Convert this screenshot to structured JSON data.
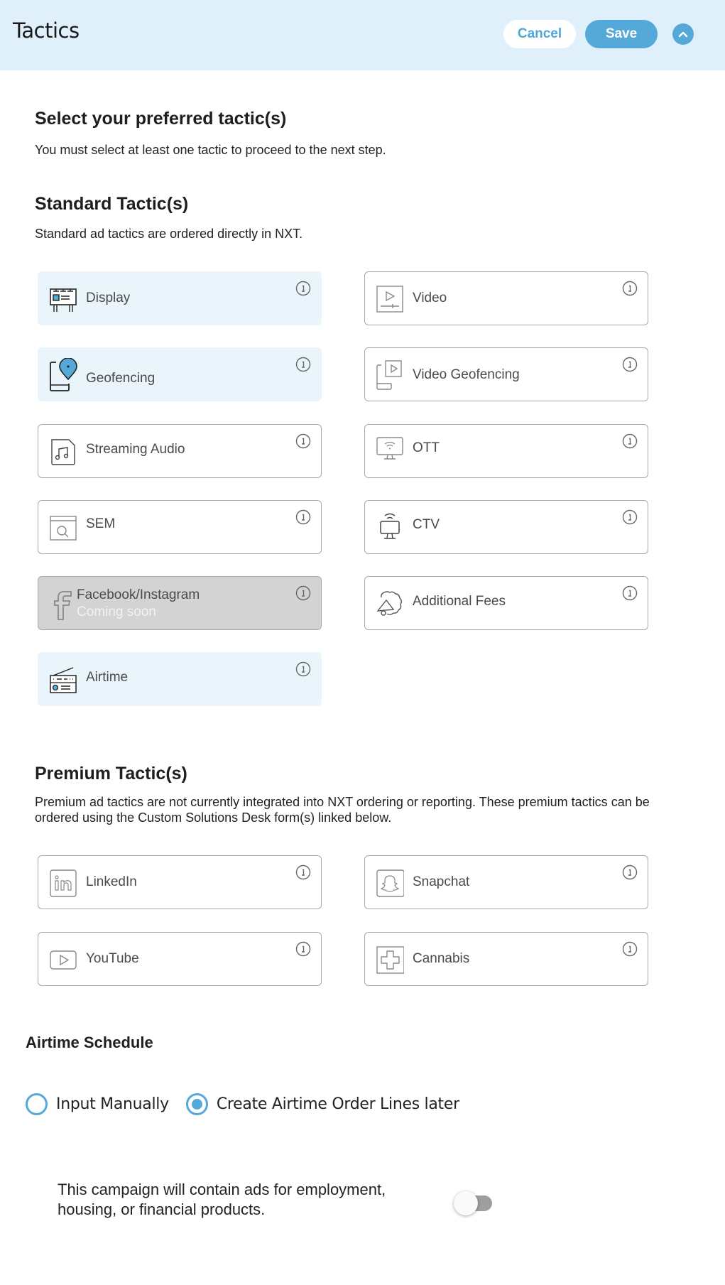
{
  "header": {
    "title": "Tactics",
    "cancel_label": "Cancel",
    "save_label": "Save",
    "collapse_icon": "chevron-up-icon"
  },
  "intro": {
    "heading": "Select your preferred tactic(s)",
    "description": "You must select at least one tactic to proceed to the next step."
  },
  "standard": {
    "heading": "Standard Tactic(s)",
    "description": "Standard ad tactics are ordered directly in NXT.",
    "tactics": [
      {
        "label": "Display",
        "icon": "billboard-icon",
        "state": "selected"
      },
      {
        "label": "Video",
        "icon": "video-player-icon",
        "state": "unselected"
      },
      {
        "label": "Geofencing",
        "icon": "phone-location-pin-icon",
        "state": "selected"
      },
      {
        "label": "Video Geofencing",
        "icon": "phone-video-icon",
        "state": "unselected"
      },
      {
        "label": "Streaming Audio",
        "icon": "music-file-icon",
        "state": "unselected"
      },
      {
        "label": "OTT",
        "icon": "monitor-wifi-icon",
        "state": "unselected"
      },
      {
        "label": "SEM",
        "icon": "browser-search-icon",
        "state": "unselected"
      },
      {
        "label": "CTV",
        "icon": "tv-signal-icon",
        "state": "unselected"
      },
      {
        "label": "Facebook/Instagram",
        "sublabel": "Coming soon",
        "icon": "facebook-icon",
        "state": "disabled"
      },
      {
        "label": "Additional Fees",
        "icon": "megaphone-badge-icon",
        "state": "unselected"
      },
      {
        "label": "Airtime",
        "icon": "radio-icon",
        "state": "selected"
      }
    ]
  },
  "premium": {
    "heading": "Premium Tactic(s)",
    "description": "Premium ad tactics are not currently integrated into NXT ordering or reporting. These premium tactics can be ordered using the Custom Solutions Desk form(s) linked below.",
    "tactics": [
      {
        "label": "LinkedIn",
        "icon": "linkedin-icon",
        "state": "unselected"
      },
      {
        "label": "Snapchat",
        "icon": "snapchat-icon",
        "state": "unselected"
      },
      {
        "label": "YouTube",
        "icon": "youtube-icon",
        "state": "unselected"
      },
      {
        "label": "Cannabis",
        "icon": "medical-cross-icon",
        "state": "unselected"
      }
    ]
  },
  "airtime_schedule": {
    "heading": "Airtime Schedule",
    "options": [
      {
        "label": "Input Manually",
        "checked": false
      },
      {
        "label": "Create Airtime Order Lines later",
        "checked": true
      }
    ]
  },
  "compliance": {
    "text": "This campaign will contain ads for employment, housing, or financial products.",
    "toggle_on": false
  },
  "colors": {
    "accent": "#55a9d8",
    "header_bg": "#dff0fa",
    "selected_card_bg": "#eaf5fb",
    "disabled_card_bg": "#d3d3d3"
  }
}
